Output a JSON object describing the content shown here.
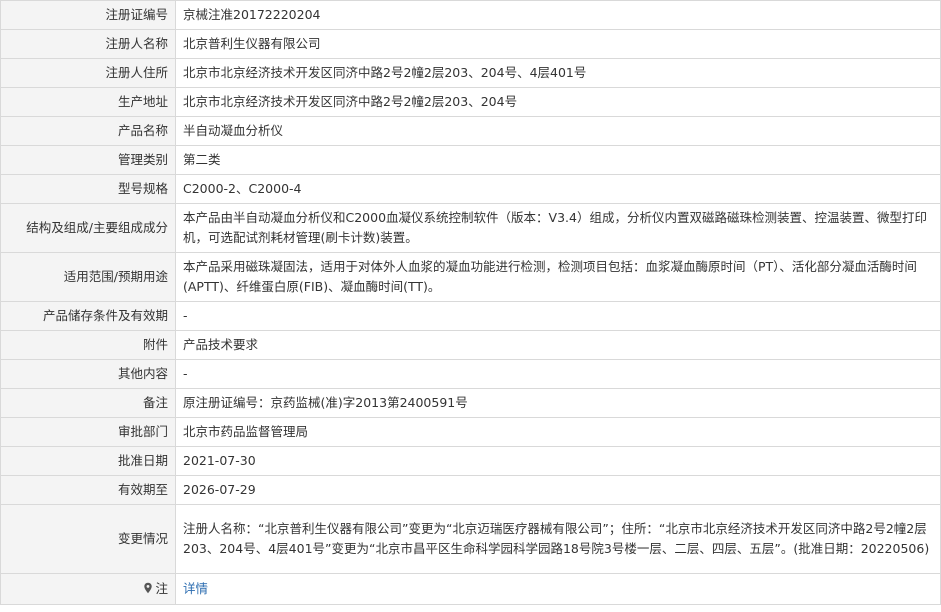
{
  "rows": [
    {
      "label": "注册证编号",
      "value": "京械注准20172220204"
    },
    {
      "label": "注册人名称",
      "value": "北京普利生仪器有限公司"
    },
    {
      "label": "注册人住所",
      "value": "北京市北京经济技术开发区同济中路2号2幢2层203、204号、4层401号"
    },
    {
      "label": "生产地址",
      "value": "北京市北京经济技术开发区同济中路2号2幢2层203、204号"
    },
    {
      "label": "产品名称",
      "value": "半自动凝血分析仪"
    },
    {
      "label": "管理类别",
      "value": "第二类"
    },
    {
      "label": "型号规格",
      "value": "C2000-2、C2000-4"
    },
    {
      "label": "结构及组成/主要组成成分",
      "value": "本产品由半自动凝血分析仪和C2000血凝仪系统控制软件（版本：V3.4）组成，分析仪内置双磁路磁珠检测装置、控温装置、微型打印机，可选配试剂耗材管理(刷卡计数)装置。"
    },
    {
      "label": "适用范围/预期用途",
      "value": "本产品采用磁珠凝固法，适用于对体外人血浆的凝血功能进行检测，检测项目包括：血浆凝血酶原时间（PT）、活化部分凝血活酶时间(APTT)、纤维蛋白原(FIB)、凝血酶时间(TT)。"
    },
    {
      "label": "产品储存条件及有效期",
      "value": "-"
    },
    {
      "label": "附件",
      "value": "产品技术要求"
    },
    {
      "label": "其他内容",
      "value": "-"
    },
    {
      "label": "备注",
      "value": "原注册证编号：京药监械(准)字2013第2400591号"
    },
    {
      "label": "审批部门",
      "value": "北京市药品监督管理局"
    },
    {
      "label": "批准日期",
      "value": "2021-07-30"
    },
    {
      "label": "有效期至",
      "value": "2026-07-29"
    },
    {
      "label": "变更情况",
      "value": "注册人名称：“北京普利生仪器有限公司”变更为“北京迈瑞医疗器械有限公司”；住所：“北京市北京经济技术开发区同济中路2号2幢2层203、204号、4层401号”变更为“北京市昌平区生命科学园科学园路18号院3号楼一层、二层、四层、五层”。(批准日期：20220506)"
    }
  ],
  "note": {
    "label": "注",
    "icon": "map-pin-icon",
    "link_text": "详情",
    "link_color": "#2b6cb0"
  }
}
